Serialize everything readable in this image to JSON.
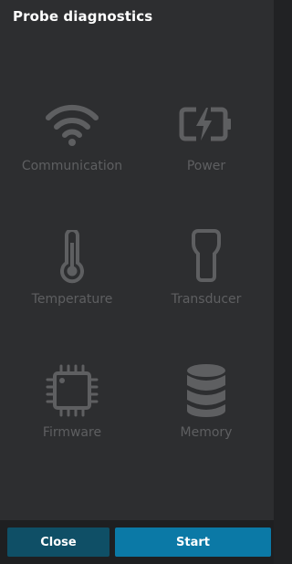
{
  "header": {
    "title": "Probe diagnostics"
  },
  "tests": [
    {
      "label": "Communication",
      "icon": "wifi-icon"
    },
    {
      "label": "Power",
      "icon": "battery-charging-icon"
    },
    {
      "label": "Temperature",
      "icon": "thermometer-icon"
    },
    {
      "label": "Transducer",
      "icon": "probe-transducer-icon"
    },
    {
      "label": "Firmware",
      "icon": "chip-icon"
    },
    {
      "label": "Memory",
      "icon": "database-icon"
    }
  ],
  "footer": {
    "close_label": "Close",
    "start_label": "Start"
  },
  "colors": {
    "background": "#2d2e30",
    "icon_disabled": "#5e5f61",
    "close_button": "#0f4f66",
    "start_button": "#0b79a6"
  }
}
